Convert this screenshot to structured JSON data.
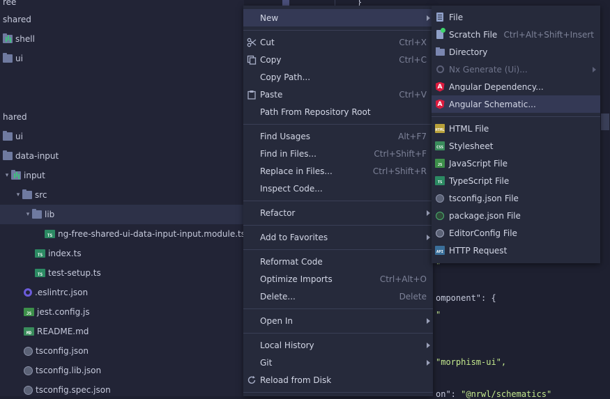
{
  "tree": {
    "rows": [
      {
        "label": "ree",
        "kind": "text"
      },
      {
        "label": "shared",
        "kind": "folder"
      },
      {
        "label": "shell",
        "kind": "modfolder"
      },
      {
        "label": "ui",
        "kind": "folder"
      },
      {
        "label": "hared",
        "kind": "text"
      },
      {
        "label": "ui",
        "kind": "folder"
      },
      {
        "label": "data-input",
        "kind": "folder"
      },
      {
        "label": "input",
        "kind": "modfolder"
      },
      {
        "label": "src",
        "kind": "folder"
      },
      {
        "label": "lib",
        "kind": "folder"
      },
      {
        "label": "ng-free-shared-ui-data-input-input.module.ts",
        "kind": "ts"
      },
      {
        "label": "index.ts",
        "kind": "ts"
      },
      {
        "label": "test-setup.ts",
        "kind": "ts"
      },
      {
        "label": ".eslintrc.json",
        "kind": "eslint"
      },
      {
        "label": "jest.config.js",
        "kind": "js"
      },
      {
        "label": "README.md",
        "kind": "md"
      },
      {
        "label": "tsconfig.json",
        "kind": "json"
      },
      {
        "label": "tsconfig.lib.json",
        "kind": "json"
      },
      {
        "label": "tsconfig.spec.json",
        "kind": "json"
      }
    ],
    "badges": {
      "ts": "TS",
      "js": "JS",
      "md": "MD"
    }
  },
  "context_menu": {
    "items": [
      {
        "label": "New",
        "arrow": true,
        "highlighted": true
      },
      {
        "label": "Cut",
        "shortcut": "Ctrl+X",
        "icon": "scissors-icon"
      },
      {
        "label": "Copy",
        "shortcut": "Ctrl+C",
        "icon": "copy-icon"
      },
      {
        "label": "Copy Path..."
      },
      {
        "label": "Paste",
        "shortcut": "Ctrl+V",
        "icon": "paste-icon"
      },
      {
        "label": "Path From Repository Root"
      },
      {
        "label": "Find Usages",
        "shortcut": "Alt+F7"
      },
      {
        "label": "Find in Files...",
        "shortcut": "Ctrl+Shift+F"
      },
      {
        "label": "Replace in Files...",
        "shortcut": "Ctrl+Shift+R"
      },
      {
        "label": "Inspect Code..."
      },
      {
        "label": "Refactor",
        "arrow": true
      },
      {
        "label": "Add to Favorites",
        "arrow": true
      },
      {
        "label": "Reformat Code"
      },
      {
        "label": "Optimize Imports",
        "shortcut": "Ctrl+Alt+O"
      },
      {
        "label": "Delete...",
        "shortcut": "Delete"
      },
      {
        "label": "Open In",
        "arrow": true
      },
      {
        "label": "Local History",
        "arrow": true
      },
      {
        "label": "Git",
        "arrow": true
      },
      {
        "label": "Reload from Disk",
        "icon": "reload-icon"
      }
    ]
  },
  "new_submenu": {
    "items": [
      {
        "label": "File",
        "icon": "file-icon"
      },
      {
        "label": "Scratch File",
        "shortcut": "Ctrl+Alt+Shift+Insert",
        "icon": "scratch-file-icon"
      },
      {
        "label": "Directory",
        "icon": "folder-icon"
      },
      {
        "label": "Nx Generate (Ui)...",
        "arrow": true,
        "disabled": true,
        "icon": "nx-icon"
      },
      {
        "label": "Angular Dependency...",
        "icon": "angular-icon"
      },
      {
        "label": "Angular Schematic...",
        "icon": "angular-icon",
        "highlighted": true
      },
      {
        "label": "HTML File",
        "icon": "html-file-icon",
        "badge": "HTML"
      },
      {
        "label": "Stylesheet",
        "icon": "css-file-icon",
        "badge": "CSS"
      },
      {
        "label": "JavaScript File",
        "icon": "js-file-icon",
        "badge": "JS"
      },
      {
        "label": "TypeScript File",
        "icon": "ts-file-icon",
        "badge": "TS"
      },
      {
        "label": "tsconfig.json File",
        "icon": "tsconfig-icon"
      },
      {
        "label": "package.json File",
        "icon": "package-json-icon"
      },
      {
        "label": "EditorConfig File",
        "icon": "editorconfig-icon"
      },
      {
        "label": "HTTP Request",
        "icon": "http-request-icon",
        "badge": "API"
      }
    ],
    "angular_glyph": "A"
  },
  "editor": {
    "lines": [
      {
        "plain": "",
        "str": "\""
      },
      {
        "plain": "omponent\": {",
        "str": ""
      },
      {
        "plain": "",
        "str": "\""
      },
      {
        "plain": "",
        "str": "\"morphism-ui\","
      },
      {
        "plain": "on\": ",
        "str": "\"@nrwl/schematics\""
      }
    ],
    "top_fragment": "}"
  }
}
